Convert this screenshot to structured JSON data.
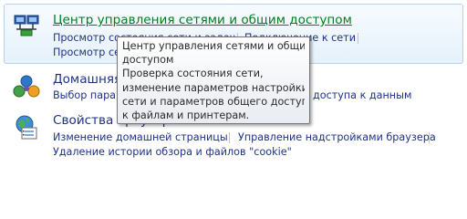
{
  "network": {
    "title": "Центр управления сетями и общим доступом",
    "links": [
      "Просмотр состояния сети и задач",
      "Подключение к сети",
      "Просмотр сетевых компьютеров и устройств"
    ]
  },
  "homegroup": {
    "title": "Домашняя группа",
    "links": [
      "Выбор параметров домашней группы и общего доступа к данным"
    ]
  },
  "browser": {
    "title": "Свойства браузера",
    "links": [
      "Изменение домашней страницы",
      "Управление надстройками браузера",
      "Удаление истории обзора и файлов \"cookie\""
    ]
  },
  "tooltip": {
    "lines": [
      "Центр управления сетями и общим",
      "доступом",
      "Проверка состояния сети,",
      "изменение параметров настройки",
      "сети и параметров общего доступа",
      "к файлам и принтерам."
    ]
  }
}
